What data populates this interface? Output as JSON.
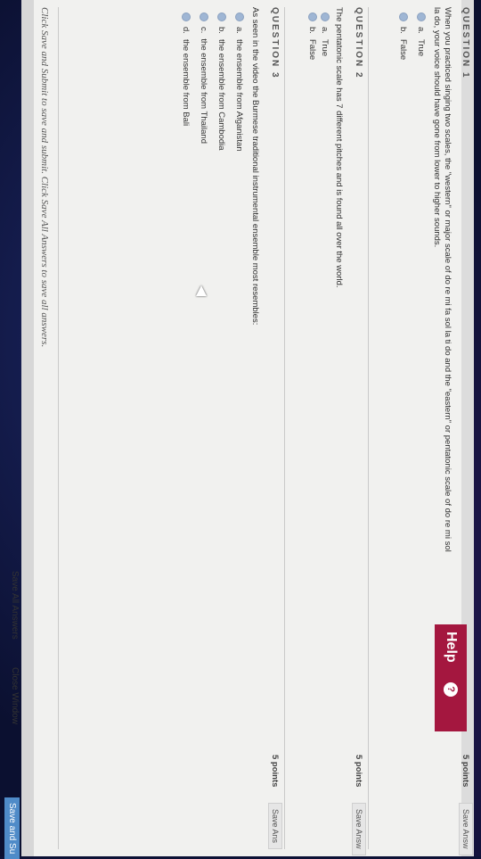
{
  "help": {
    "label": "Help",
    "icon": "question-mark-icon"
  },
  "questions": [
    {
      "header": "QUESTION 1",
      "points": "5 points",
      "save_label": "Save Answ",
      "text_line1": "When you practiced singing two scales, the \"western\" or major scale of do re mi fa sol la ti do and the \"eastern\" or pentatonic scale of do re mi sol",
      "text_line2": "la do, your voice should have gone from lower to higher sounds.",
      "options": [
        {
          "letter": "a.",
          "text": "True"
        },
        {
          "letter": "b.",
          "text": "False"
        }
      ]
    },
    {
      "header": "QUESTION 2",
      "points": "5 points",
      "save_label": "Save Answ",
      "text_line1": "The pentatonic scale has 7 different pitches and is found all over the world.",
      "options": [
        {
          "letter": "a.",
          "text": "True"
        },
        {
          "letter": "b.",
          "text": "False"
        }
      ]
    },
    {
      "header": "QUESTION 3",
      "points": "5 points",
      "save_label": "Save Ans",
      "text_line1": "As seen in the video the Burmese traditional instrumental ensemble most resembles:",
      "options": [
        {
          "letter": "a.",
          "text": "the ensemble from Afganistan"
        },
        {
          "letter": "b.",
          "text": "the ensemble from Cambodia"
        },
        {
          "letter": "c.",
          "text": "the ensemble from Thailand"
        },
        {
          "letter": "d.",
          "text": "the ensemble from Bali"
        }
      ]
    }
  ],
  "footer": {
    "instruction": "Click Save and Submit to save and submit. Click Save All Answers to save all answers.",
    "save_all": "Save All Answers",
    "close_window": "Close Window",
    "save_submit": "Save and Su"
  },
  "colors": {
    "help_bg": "#a4173f",
    "primary_button": "#4f8bc8"
  }
}
